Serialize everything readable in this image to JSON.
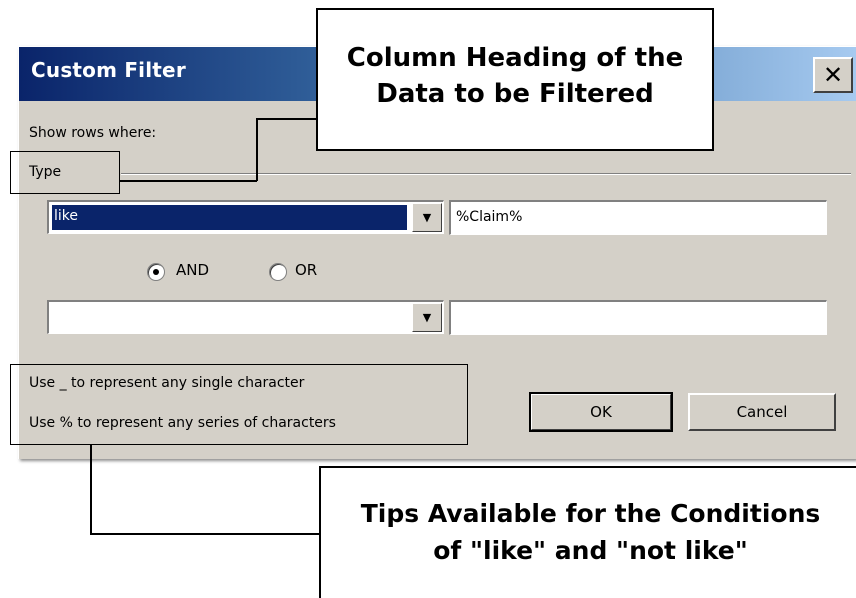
{
  "dialog": {
    "title": "Custom Filter",
    "close_symbol": "✕",
    "show_rows_label": "Show rows where:",
    "group_label": "Type",
    "condition1": {
      "operator": "like",
      "value": "%Claim%"
    },
    "logic": {
      "and_label": "AND",
      "or_label": "OR",
      "selected": "AND"
    },
    "condition2": {
      "operator": "",
      "value": ""
    },
    "tips": [
      "Use _ to represent any single character",
      "Use % to represent any series of characters"
    ],
    "ok_label": "OK",
    "cancel_label": "Cancel"
  },
  "annotations": {
    "column_heading": [
      "Column Heading of the",
      "Data to be Filtered"
    ],
    "tips": [
      "Tips Available for the Conditions",
      "of \"like\" and \"not like\""
    ]
  },
  "icons": {
    "dropdown_arrow": "▼"
  },
  "colors": {
    "title_start": "#0a246a",
    "title_end": "#a6caf0",
    "dialog_face": "#d4d0c8",
    "selection": "#0a246a"
  }
}
